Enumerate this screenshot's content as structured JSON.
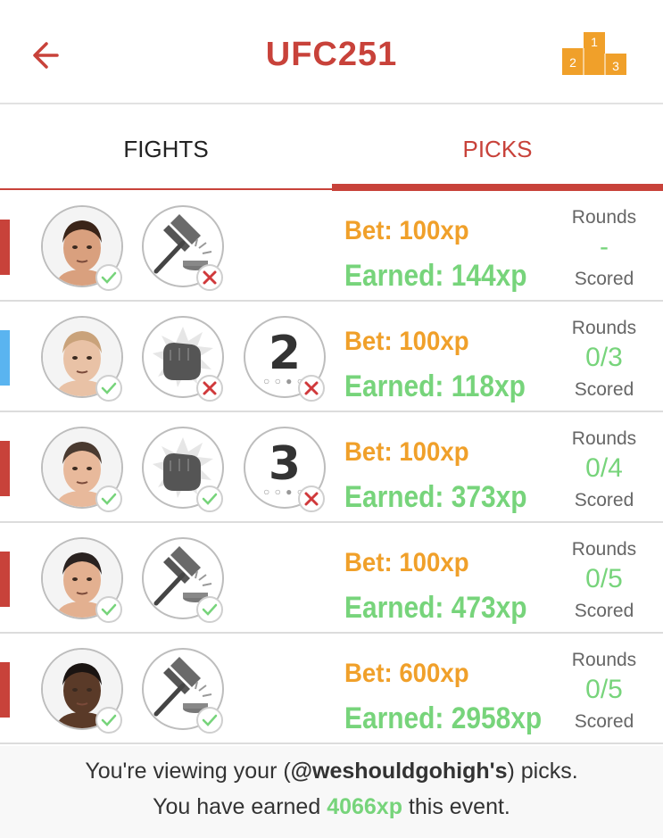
{
  "header": {
    "title": "UFC251",
    "back_icon": "back-arrow-icon",
    "podium_icon": "podium-icon",
    "podium_places": [
      "1",
      "2",
      "3"
    ]
  },
  "tabs": [
    {
      "label": "FIGHTS",
      "active": false
    },
    {
      "label": "PICKS",
      "active": true
    }
  ],
  "colors": {
    "accent": "#c8423a",
    "bet": "#f0a02a",
    "earned": "#77d47b",
    "corner_red": "#c8423a",
    "corner_blue": "#5ab4f0"
  },
  "picks": [
    {
      "corner": "red",
      "fighter_icon": "fighter-avatar",
      "method_icon": "decision-gavel-icon",
      "method_correct": false,
      "round_pick": null,
      "bet_text": "Bet: 100xp",
      "earned_text": "Earned: 144xp",
      "rounds_label": "Rounds",
      "rounds_value": "-",
      "scored_label": "Scored",
      "fighter_correct": true
    },
    {
      "corner": "blue",
      "fighter_icon": "fighter-avatar",
      "method_icon": "ko-punch-icon",
      "method_correct": false,
      "round_pick": "2",
      "round_correct": false,
      "bet_text": "Bet: 100xp",
      "earned_text": "Earned: 118xp",
      "rounds_label": "Rounds",
      "rounds_value": "0/3",
      "scored_label": "Scored",
      "fighter_correct": true
    },
    {
      "corner": "red",
      "fighter_icon": "fighter-avatar",
      "method_icon": "ko-punch-icon",
      "method_correct": true,
      "round_pick": "3",
      "round_correct": false,
      "bet_text": "Bet: 100xp",
      "earned_text": "Earned: 373xp",
      "rounds_label": "Rounds",
      "rounds_value": "0/4",
      "scored_label": "Scored",
      "fighter_correct": true
    },
    {
      "corner": "red",
      "fighter_icon": "fighter-avatar",
      "method_icon": "decision-gavel-icon",
      "method_correct": true,
      "round_pick": null,
      "bet_text": "Bet: 100xp",
      "earned_text": "Earned: 473xp",
      "rounds_label": "Rounds",
      "rounds_value": "0/5",
      "scored_label": "Scored",
      "fighter_correct": true
    },
    {
      "corner": "red",
      "fighter_icon": "fighter-avatar",
      "method_icon": "decision-gavel-icon",
      "method_correct": true,
      "round_pick": null,
      "bet_text": "Bet: 600xp",
      "earned_text": "Earned: 2958xp",
      "rounds_label": "Rounds",
      "rounds_value": "0/5",
      "scored_label": "Scored",
      "fighter_correct": true
    }
  ],
  "footer": {
    "line1_prefix": "You're viewing your (",
    "username": "@weshouldgohigh's",
    "line1_suffix": ") picks.",
    "line2_prefix": "You have earned ",
    "total_xp": "4066xp",
    "line2_suffix": " this event."
  }
}
